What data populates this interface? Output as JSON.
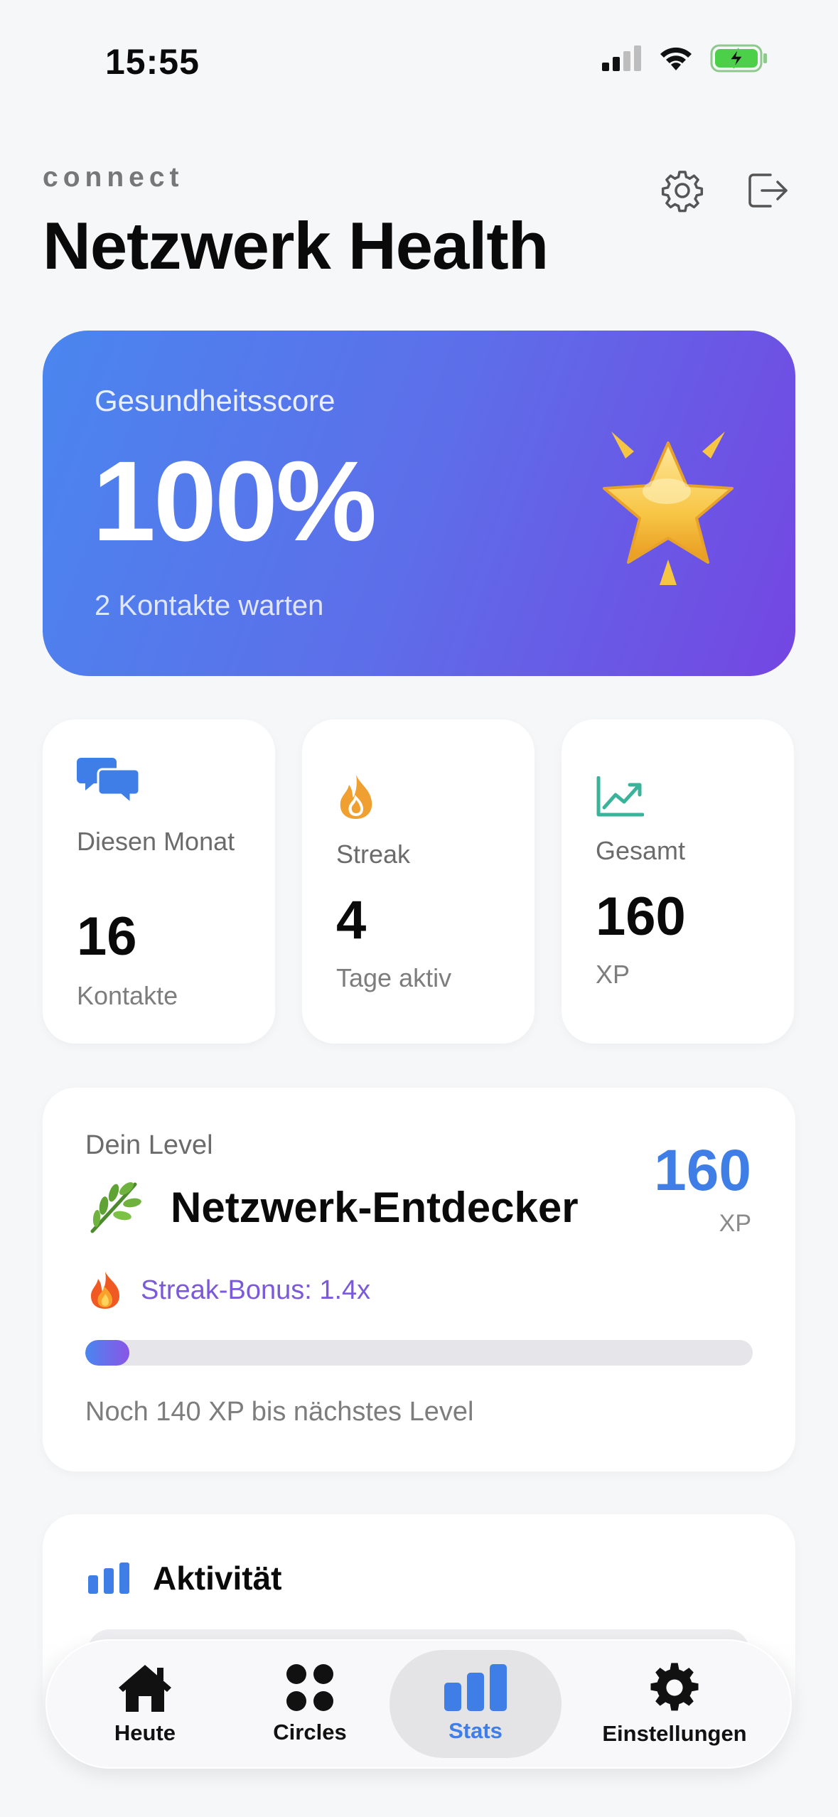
{
  "status_bar": {
    "time": "15:55"
  },
  "header": {
    "brand": "connect",
    "title": "Netzwerk Health"
  },
  "score_card": {
    "label": "Gesundheitsscore",
    "value": "100%",
    "subtitle": "2 Kontakte warten",
    "icon": "star-emoji"
  },
  "stats": [
    {
      "icon": "chat-bubbles-icon",
      "label": "Diesen Monat",
      "value": "16",
      "sub": "Kontakte"
    },
    {
      "icon": "flame-icon",
      "label": "Streak",
      "value": "4",
      "sub": "Tage aktiv"
    },
    {
      "icon": "trend-chart-icon",
      "label": "Gesamt",
      "value": "160",
      "sub": "XP"
    }
  ],
  "level": {
    "label": "Dein Level",
    "icon": "herb-emoji",
    "name": "Netzwerk-Entdecker",
    "xp": "160",
    "xp_unit": "XP",
    "bonus_icon": "fire-emoji",
    "bonus_text": "Streak-Bonus: 1.4x",
    "progress_fraction": 0.066,
    "next_text": "Noch 140 XP bis nächstes Level"
  },
  "activity": {
    "icon": "bar-chart-icon",
    "title": "Aktivität"
  },
  "tabs": [
    {
      "label": "Heute",
      "icon": "house-icon",
      "active": false
    },
    {
      "label": "Circles",
      "icon": "four-dots-icon",
      "active": false
    },
    {
      "label": "Stats",
      "icon": "bar-chart-icon",
      "active": true
    },
    {
      "label": "Einstellungen",
      "icon": "gear-icon",
      "active": false
    }
  ],
  "colors": {
    "accent": "#3f7ee6",
    "gradient_start": "#4a86ef",
    "gradient_end": "#7446e2",
    "bonus": "#7a5ad8",
    "background": "#f6f7f9"
  }
}
